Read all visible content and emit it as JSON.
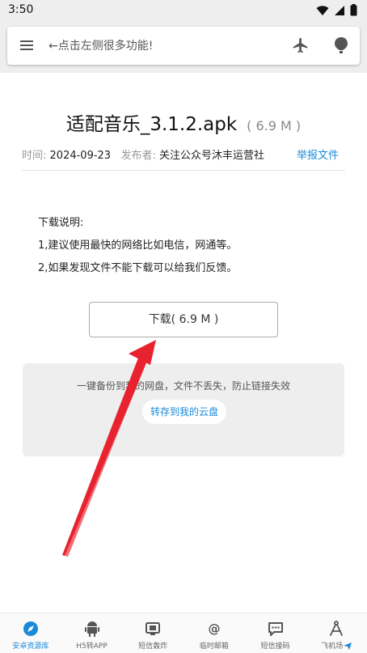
{
  "status_bar": {
    "time": "3:50"
  },
  "header": {
    "search_placeholder": "←点击左侧很多功能!"
  },
  "file": {
    "name": "适配音乐_3.1.2.apk",
    "size": "( 6.9 M )",
    "time_label": "时间:",
    "time_value": "2024-09-23",
    "publisher_label": "发布者:",
    "publisher_value": "关注公众号沐丰运营社",
    "report_link": "举报文件"
  },
  "instructions": {
    "title": "下载说明:",
    "line1": "1,建议使用最快的网络比如电信，网通等。",
    "line2": "2,如果发现文件不能下载可以给我们反馈。"
  },
  "download_button": "下载( 6.9 M )",
  "cloud": {
    "text": "一键备份到我的网盘，文件不丢失，防止链接失效",
    "button": "转存到我的云盘"
  },
  "bottom_nav": {
    "items": [
      {
        "label": "安卓资源库",
        "icon": "compass-icon",
        "active": true
      },
      {
        "label": "H5转APP",
        "icon": "android-icon",
        "active": false
      },
      {
        "label": "短信轰炸",
        "icon": "tv-icon",
        "active": false
      },
      {
        "label": "临时邮箱",
        "icon": "at-icon",
        "active": false
      },
      {
        "label": "短信接码",
        "icon": "message-icon",
        "active": false
      },
      {
        "label": "飞机场",
        "icon": "compass-tool-icon",
        "active": false
      }
    ]
  },
  "colors": {
    "accent": "#1a8ad8",
    "arrow": "#e8232f",
    "header_bg": "#eeeeee"
  }
}
